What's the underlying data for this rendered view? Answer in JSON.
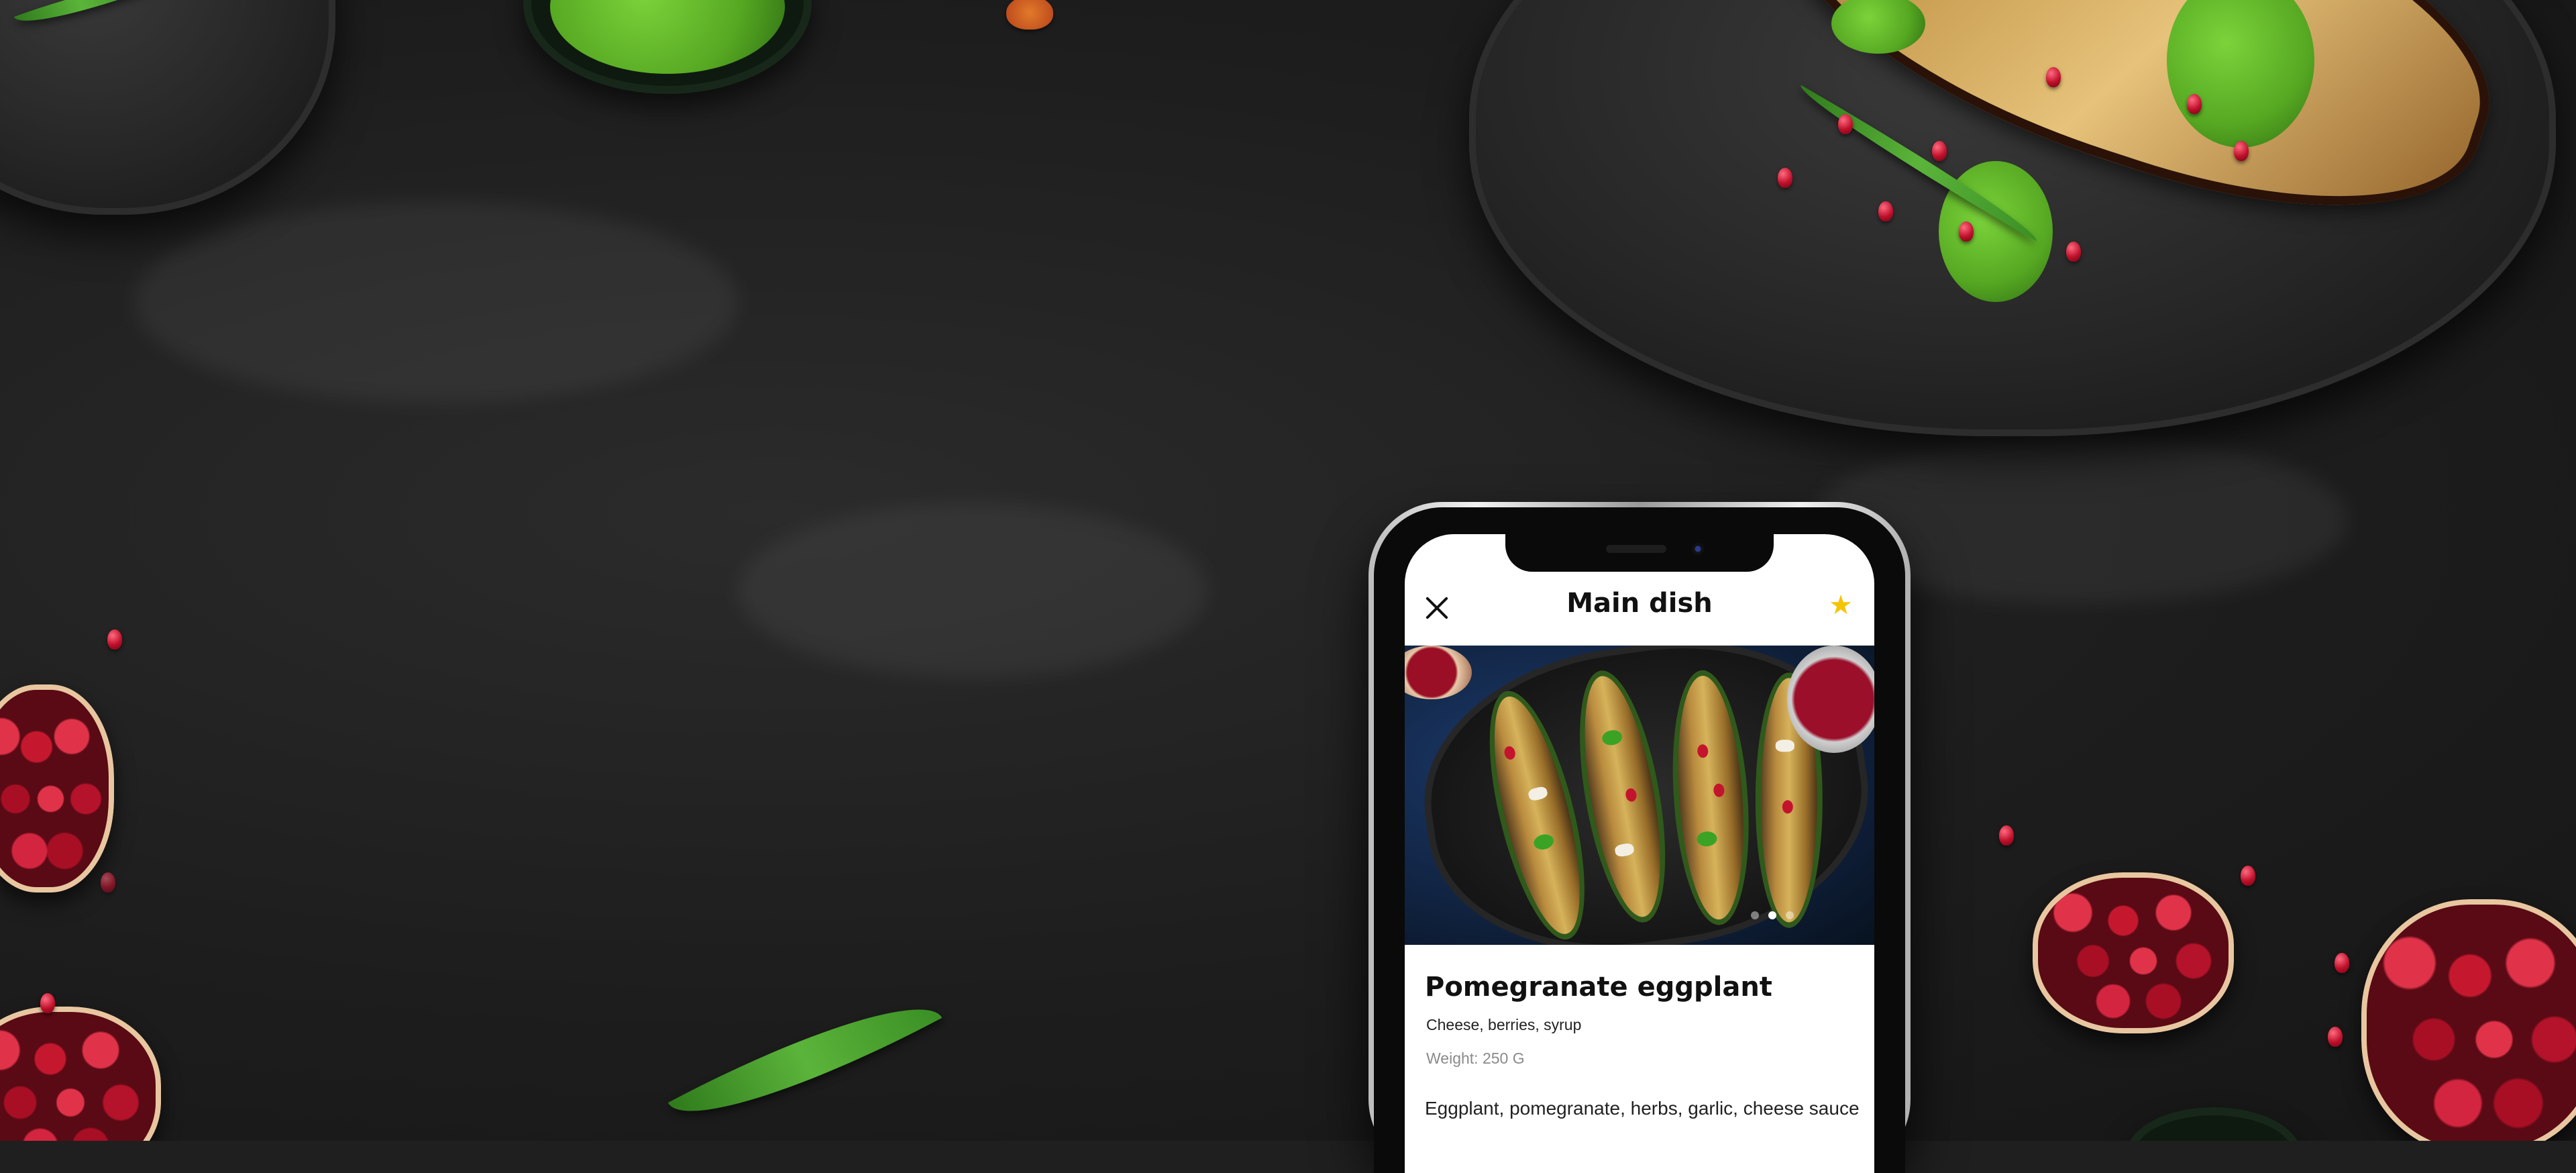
{
  "app": {
    "header_title": "Main dish",
    "close_icon": "close-icon",
    "favorite_icon": "star-icon",
    "favorite_glyph": "★",
    "favorite_color": "#f5c400"
  },
  "carousel": {
    "slide_count": 3,
    "active_index": 1
  },
  "dish": {
    "name": "Pomegranate eggplant",
    "subtitle": "Cheese, berries, syrup",
    "weight": "Weight: 250 G",
    "ingredients": "Eggplant, pomegranate, herbs, garlic, cheese sauce"
  },
  "colors": {
    "background": "#1f1f1f",
    "accent": "#f5c400",
    "text_primary": "#111111",
    "text_secondary": "#8a8a8a"
  }
}
